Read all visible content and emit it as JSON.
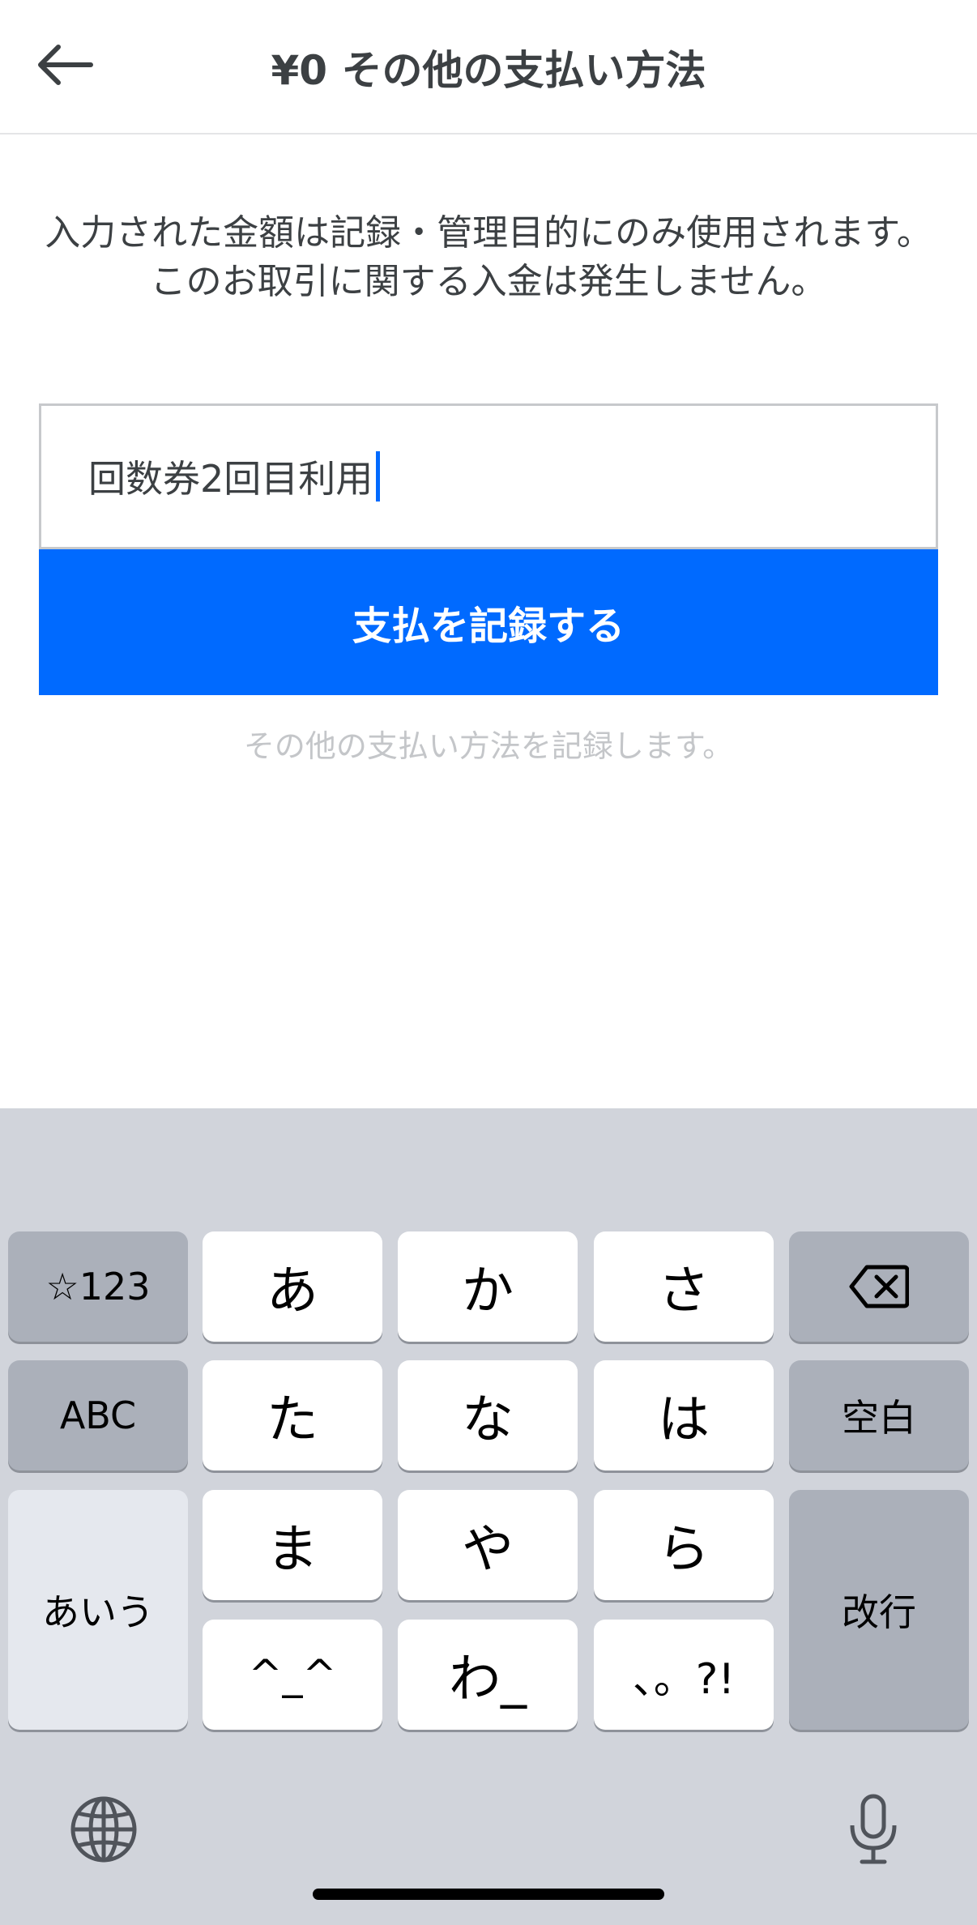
{
  "header": {
    "title": "¥0 その他の支払い方法"
  },
  "description": "入力された金額は記録・管理目的にのみ使用されます。このお取引に関する入金は発生しません。",
  "memo": {
    "value": "回数券2回目利用"
  },
  "record_button": {
    "label": "支払を記録する"
  },
  "helper_text": "その他の支払い方法を記録します。",
  "keyboard": {
    "keys": {
      "symbols": "☆123",
      "a": "あ",
      "ka": "か",
      "sa": "さ",
      "abc": "ABC",
      "ta": "た",
      "na": "な",
      "ha": "は",
      "space": "空白",
      "ma": "ま",
      "ya": "や",
      "ra": "ら",
      "aiu": "あいう",
      "kaomoji": "^_^",
      "wa": "わ_",
      "punct": "、。?!",
      "enter": "改行"
    },
    "icons": {
      "backspace": "backspace-icon",
      "globe": "globe-icon",
      "mic": "microphone-icon"
    }
  },
  "colors": {
    "accent": "#006aff",
    "text": "#3c4043",
    "keyboard_bg": "#d1d4db",
    "special_key": "#abb0ba"
  }
}
